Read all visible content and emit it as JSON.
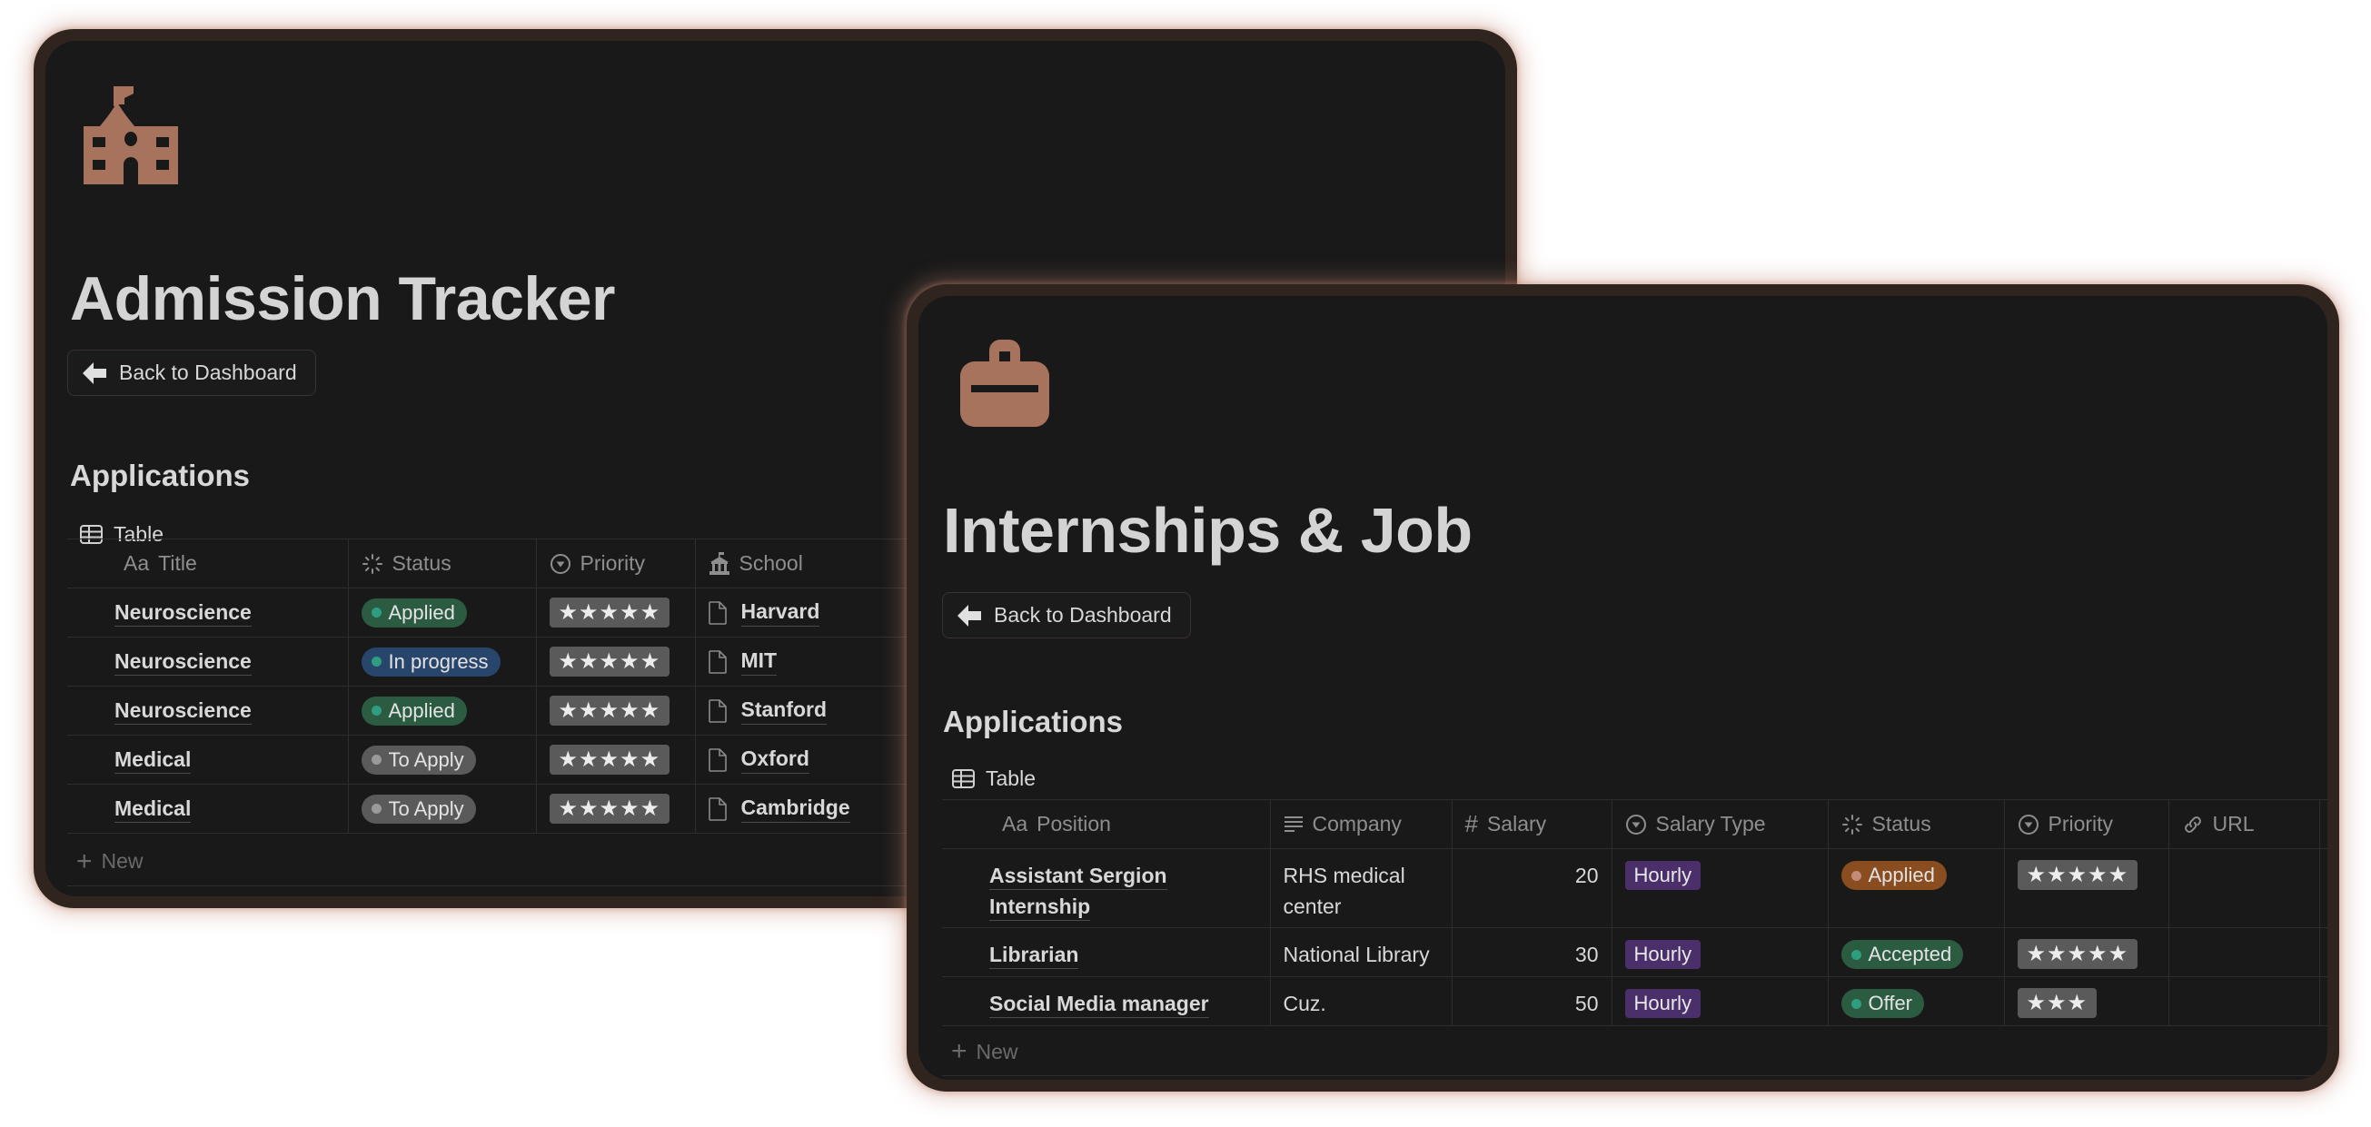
{
  "colors": {
    "accent_icon": "#a8735c",
    "window_frame": "#30241f",
    "window_bg": "#191919",
    "green_pill": "#2b5c42",
    "green_dot": "#2f9e80",
    "blue_pill": "#28456b",
    "gray_pill": "#5a5a5a",
    "gray_dot": "#9a9a9a",
    "orange_pill": "#8a4d1f",
    "orange_dot": "#c48a7a",
    "purple_tag": "#4a2f6b",
    "stars_bg": "#5a5a5a"
  },
  "admission": {
    "icon": "school-icon",
    "title": "Admission Tracker",
    "back_button": "Back to Dashboard",
    "section_title": "Applications",
    "view_tab": "Table",
    "columns": [
      {
        "label": "Title",
        "icon": "aa-text-icon"
      },
      {
        "label": "Status",
        "icon": "status-spinner-icon"
      },
      {
        "label": "Priority",
        "icon": "select-icon"
      },
      {
        "label": "School",
        "icon": "institution-icon"
      }
    ],
    "rows": [
      {
        "title": "Neuroscience",
        "status": "Applied",
        "status_color": "green",
        "priority_stars": 5,
        "school": "Harvard"
      },
      {
        "title": "Neuroscience",
        "status": "In progress",
        "status_color": "blue",
        "priority_stars": 5,
        "school": "MIT"
      },
      {
        "title": "Neuroscience",
        "status": "Applied",
        "status_color": "green",
        "priority_stars": 5,
        "school": "Stanford"
      },
      {
        "title": "Medical",
        "status": "To Apply",
        "status_color": "gray",
        "priority_stars": 5,
        "school": "Oxford"
      },
      {
        "title": "Medical",
        "status": "To Apply",
        "status_color": "gray",
        "priority_stars": 5,
        "school": "Cambridge"
      }
    ],
    "new_label": "New"
  },
  "internships": {
    "icon": "briefcase-icon",
    "title": "Internships & Job",
    "back_button": "Back to Dashboard",
    "section_title": "Applications",
    "view_tab": "Table",
    "columns": [
      {
        "label": "Position",
        "icon": "aa-text-icon"
      },
      {
        "label": "Company",
        "icon": "text-lines-icon"
      },
      {
        "label": "Salary",
        "icon": "hash-icon"
      },
      {
        "label": "Salary Type",
        "icon": "select-icon"
      },
      {
        "label": "Status",
        "icon": "status-spinner-icon"
      },
      {
        "label": "Priority",
        "icon": "select-icon"
      },
      {
        "label": "URL",
        "icon": "link-icon"
      }
    ],
    "rows": [
      {
        "position_line1": "Assistant Sergion",
        "position_line2": "Internship",
        "company_line1": "RHS medical",
        "company_line2": "center",
        "salary": "20",
        "salary_type": "Hourly",
        "status": "Applied",
        "status_color": "orange",
        "priority_stars": 5,
        "url": ""
      },
      {
        "position_line1": "Librarian",
        "position_line2": "",
        "company_line1": "National Library",
        "company_line2": "",
        "salary": "30",
        "salary_type": "Hourly",
        "status": "Accepted",
        "status_color": "green",
        "priority_stars": 5,
        "url": ""
      },
      {
        "position_line1": "Social Media manager",
        "position_line2": "",
        "company_line1": "Cuz.",
        "company_line2": "",
        "salary": "50",
        "salary_type": "Hourly",
        "status": "Offer",
        "status_color": "green",
        "priority_stars": 3,
        "url": ""
      }
    ],
    "new_label": "New"
  }
}
